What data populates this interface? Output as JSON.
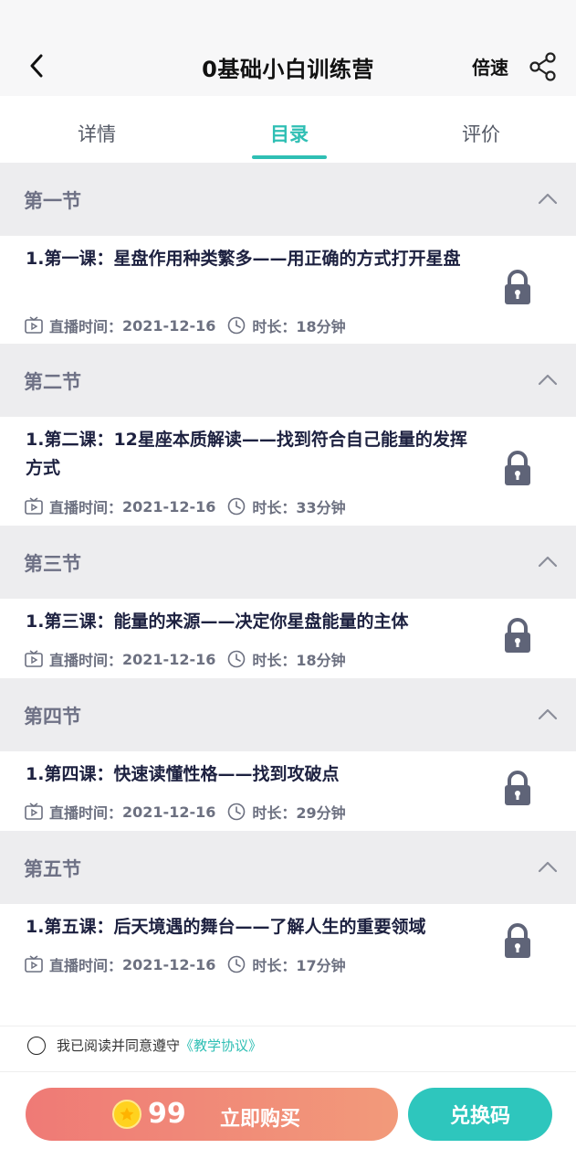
{
  "header": {
    "title": "0基础小白训练营",
    "speed_label": "倍速",
    "back_icon": "chevron-left-icon",
    "share_icon": "share-icon"
  },
  "tabs": [
    {
      "label": "详情",
      "active": false
    },
    {
      "label": "目录",
      "active": true
    },
    {
      "label": "评价",
      "active": false
    }
  ],
  "sections": [
    {
      "title": "第一节",
      "lessons": [
        {
          "title": "1.第一课：星盘作用种类繁多——用正确的方式打开星盘",
          "live_label": "直播时间：",
          "live_date": "2021-12-16",
          "duration_label": "时长：",
          "duration": "18分钟"
        }
      ]
    },
    {
      "title": "第二节",
      "lessons": [
        {
          "title": "1.第二课：12星座本质解读——找到符合自己能量的发挥方式",
          "live_label": "直播时间：",
          "live_date": "2021-12-16",
          "duration_label": "时长：",
          "duration": "33分钟"
        }
      ]
    },
    {
      "title": "第三节",
      "lessons": [
        {
          "title": "1.第三课：能量的来源——决定你星盘能量的主体",
          "live_label": "直播时间：",
          "live_date": "2021-12-16",
          "duration_label": "时长：",
          "duration": "18分钟"
        }
      ]
    },
    {
      "title": "第四节",
      "lessons": [
        {
          "title": "1.第四课：快速读懂性格——找到攻破点",
          "live_label": "直播时间：",
          "live_date": "2021-12-16",
          "duration_label": "时长：",
          "duration": "29分钟"
        }
      ]
    },
    {
      "title": "第五节",
      "lessons": [
        {
          "title": "1.第五课：后天境遇的舞台——了解人生的重要领域",
          "live_label": "直播时间：",
          "live_date": "2021-12-16",
          "duration_label": "时长：",
          "duration": "17分钟"
        }
      ]
    }
  ],
  "agreement": {
    "text": "我已阅读并同意遵守",
    "link": "《教学协议》",
    "checked": false
  },
  "footer": {
    "price": "99",
    "buy_label": "立即购买",
    "redeem_label": "兑换码"
  },
  "colors": {
    "accent": "#2fbfb4",
    "buy_gradient_start": "#ef7a76",
    "buy_gradient_end": "#f29a7a",
    "coin": "#ffd21f"
  }
}
